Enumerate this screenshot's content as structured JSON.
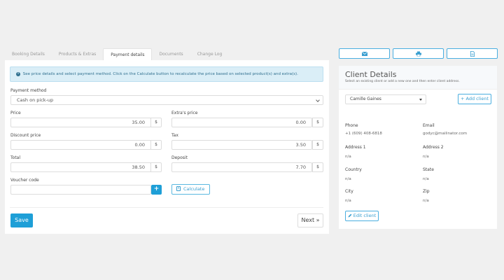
{
  "tabs": [
    "Booking Details",
    "Products & Extras",
    "Payment details",
    "Documents",
    "Change Log"
  ],
  "active_tab": "Payment details",
  "info": {
    "icon": "info-circle-icon",
    "text": "See price details and select payment method. Click on the Calculate button to recalculate the price based on selected product(s) and extra(s)."
  },
  "payment": {
    "method_label": "Payment method",
    "method_value": "Cash on pick-up",
    "price_label": "Price",
    "price_value": "35.00",
    "extras_label": "Extra's price",
    "extras_value": "0.00",
    "discount_label": "Discount price",
    "discount_value": "0.00",
    "tax_label": "Tax",
    "tax_value": "3.50",
    "total_label": "Total",
    "total_value": "38.50",
    "deposit_label": "Deposit",
    "deposit_value": "7.70",
    "currency": "$",
    "voucher_label": "Voucher code",
    "voucher_value": "",
    "plus": "+",
    "calculate_label": "Calculate"
  },
  "buttons": {
    "save": "Save",
    "next": "Next »"
  },
  "actions": [
    "envelope-icon",
    "print-icon",
    "document-icon"
  ],
  "client": {
    "title": "Client Details",
    "subtitle": "Select an existing client or add a new one and then enter client address.",
    "selected": "Camille Gaines",
    "add_label": "+ Add client",
    "phone_label": "Phone",
    "phone_value": "+1 (609) 408-6818",
    "email_label": "Email",
    "email_value": "godyc@mailinator.com",
    "address1_label": "Address 1",
    "address1_value": "n/a",
    "address2_label": "Address 2",
    "address2_value": "n/a",
    "country_label": "Country",
    "country_value": "n/a",
    "state_label": "State",
    "state_value": "n/a",
    "city_label": "City",
    "city_value": "n/a",
    "zip_label": "Zip",
    "zip_value": "n/a",
    "edit_label": "Edit client"
  },
  "colors": {
    "accent": "#1e9fd7",
    "info_bg": "#daeef7",
    "info_text": "#31708f"
  }
}
